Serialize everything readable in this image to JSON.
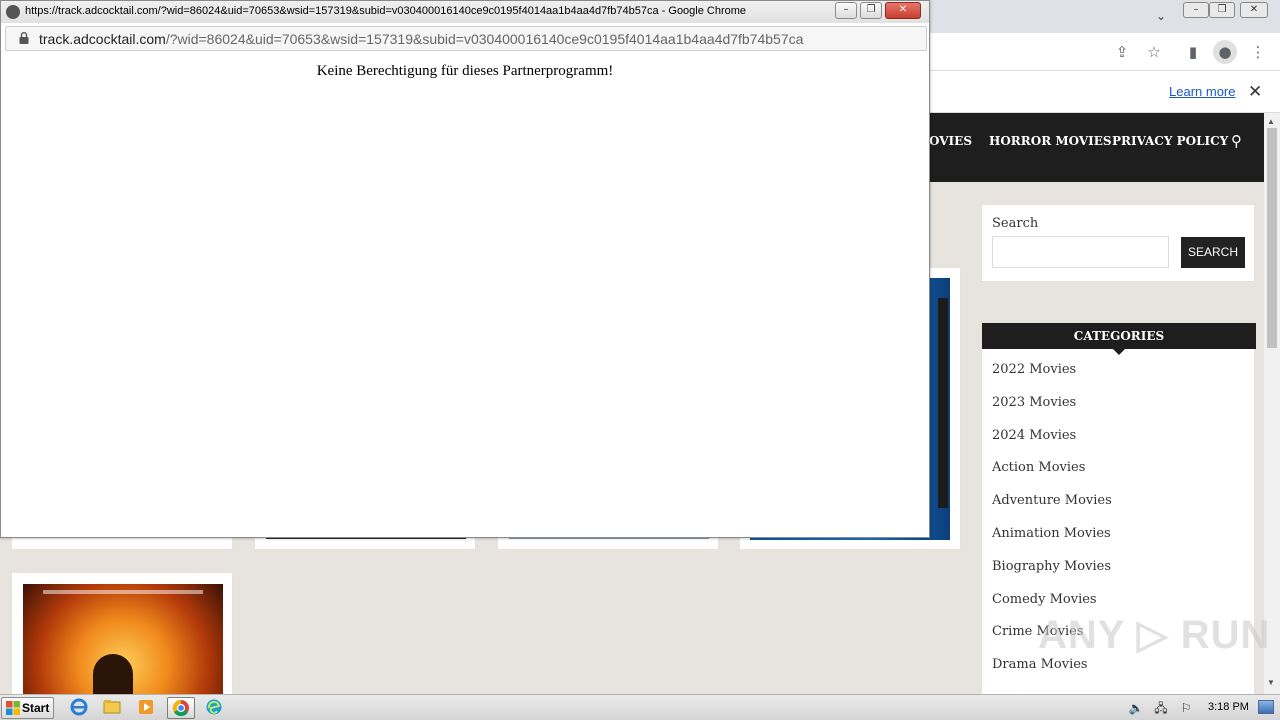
{
  "background_browser": {
    "window_controls": {
      "minimize": "–",
      "maximize": "❐",
      "close": "✕"
    },
    "tab_list_chevron": "⌄",
    "infobar": {
      "learn_more": "Learn more",
      "close": "✕"
    },
    "site_nav": {
      "items": [
        "OVIES",
        "HORROR MOVIES",
        "PRIVACY POLICY"
      ],
      "search_icon": "magnifier-icon"
    },
    "sidebar": {
      "search": {
        "title": "Search",
        "input_value": "",
        "button": "SEARCH"
      },
      "categories": {
        "title": "CATEGORIES",
        "items": [
          "2022 Movies",
          "2023 Movies",
          "2024 Movies",
          "Action Movies",
          "Adventure Movies",
          "Animation Movies",
          "Biography Movies",
          "Comedy Movies",
          "Crime Movies",
          "Drama Movies"
        ]
      }
    },
    "watermark": "ANY RUN"
  },
  "popup": {
    "title": "https://track.adcocktail.com/?wid=86024&uid=70653&wsid=157319&subid=v030400016140ce9c0195f4014aa1b4aa4d7fb74b57ca - Google Chrome",
    "url_host": "track.adcocktail.com",
    "url_path": "/?wid=86024&uid=70653&wsid=157319&subid=v030400016140ce9c0195f4014aa1b4aa4d7fb74b57ca",
    "message": "Keine Berechtigung für dieses Partnerprogramm!"
  },
  "taskbar": {
    "start_label": "Start",
    "apps": [
      "internet-explorer-icon",
      "file-explorer-icon",
      "media-player-icon",
      "chrome-icon",
      "edge-icon"
    ],
    "tray": [
      "volume-icon",
      "network-icon",
      "flag-icon"
    ],
    "clock": "3:18 PM"
  },
  "colors": {
    "nav_bg": "#1e1e1e",
    "page_bg": "#e7e4df",
    "link_blue": "#1a57c9",
    "close_red": "#c63f31"
  }
}
